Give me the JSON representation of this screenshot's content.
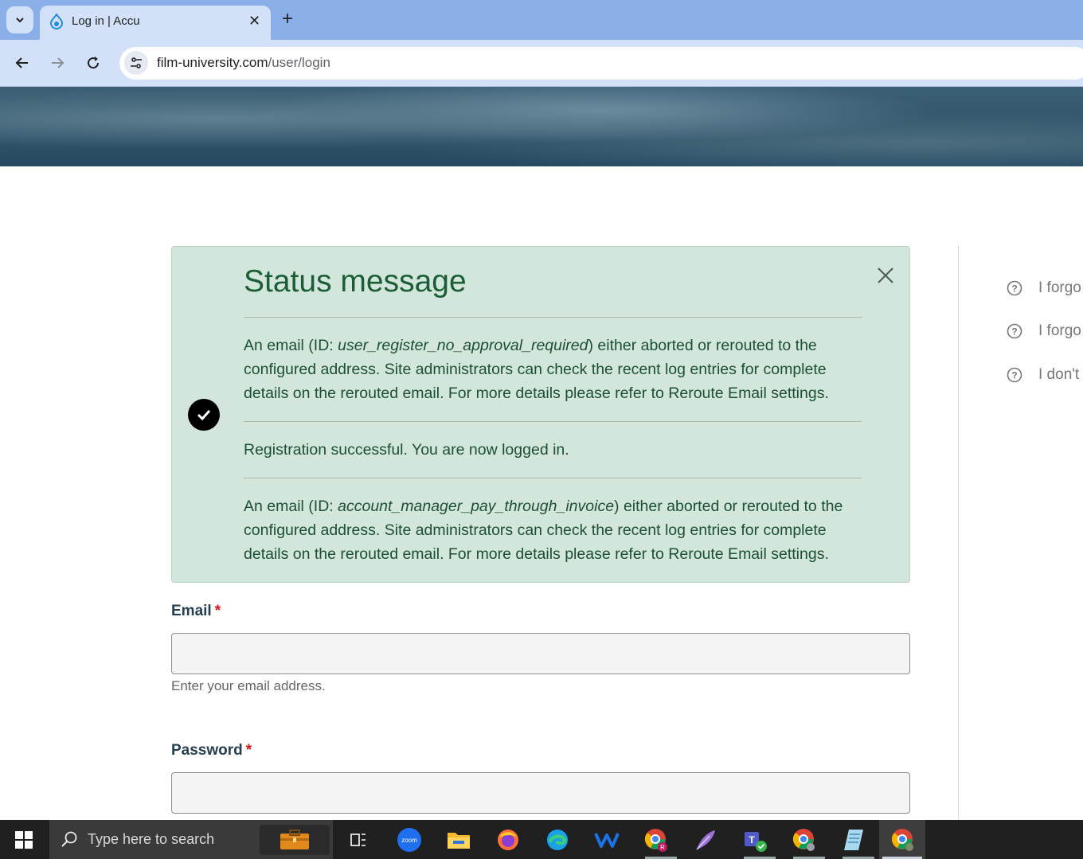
{
  "browser": {
    "tab": {
      "title": "Log in | Accu",
      "favicon": "drupal-drop-icon"
    },
    "url": {
      "host": "film-university.com",
      "path": "/user/login"
    }
  },
  "status": {
    "title": "Status message",
    "messages": [
      {
        "prefix": "An email (ID: ",
        "id": "user_register_no_approval_required",
        "suffix": ") either aborted or rerouted to the configured address. Site administrators can check the recent log entries for complete details on the rerouted email. For more details please refer to Reroute Email settings."
      },
      {
        "text": "Registration successful. You are now logged in."
      },
      {
        "prefix": "An email (ID: ",
        "id": "account_manager_pay_through_invoice",
        "suffix": ") either aborted or rerouted to the configured address. Site administrators can check the recent log entries for complete details on the rerouted email. For more details please refer to Reroute Email settings."
      }
    ]
  },
  "form": {
    "email_label": "Email",
    "email_help": "Enter your email address.",
    "password_label": "Password",
    "required_mark": "*"
  },
  "sidebar": {
    "links": [
      "I forgo",
      "I forgo",
      "I don't"
    ]
  },
  "taskbar": {
    "search_placeholder": "Type here to search",
    "apps": [
      "briefcase-icon",
      "task-view-icon",
      "zoom-icon",
      "file-explorer-icon",
      "firefox-icon",
      "edge-icon",
      "w-app-icon",
      "chrome-profile-icon",
      "feather-icon",
      "teams-icon",
      "chrome-icon",
      "notepad-icon",
      "chrome-active-icon"
    ]
  },
  "colors": {
    "status_bg": "#d2e6dc",
    "status_text": "#1b5e35",
    "required": "#dd1111"
  }
}
